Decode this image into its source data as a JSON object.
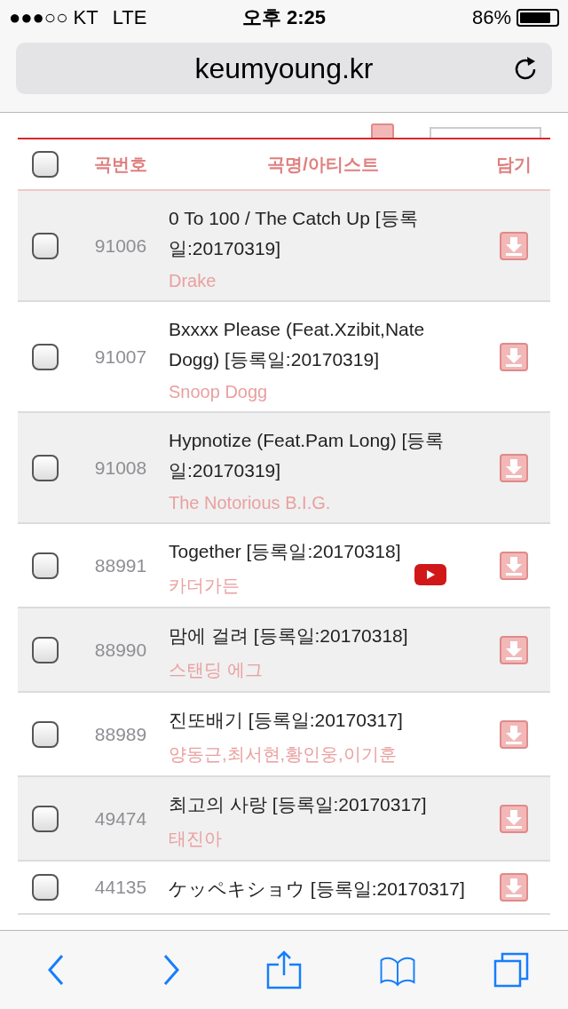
{
  "status_bar": {
    "carrier": "●●●○○ KT",
    "network": "LTE",
    "time": "오후 2:25",
    "battery": "86%"
  },
  "address_bar": {
    "url": "keumyoung.kr"
  },
  "table": {
    "all_checked": false,
    "columns": [
      "곡번호",
      "곡명/아티스트",
      "담기"
    ],
    "rows": [
      {
        "number": "91006",
        "title": "0 To 100 / The Catch Up [등록일:20170319]",
        "artist": "Drake",
        "checked": false,
        "video": false
      },
      {
        "number": "91007",
        "title": "Bxxxx Please (Feat.Xzibit,Nate Dogg) [등록일:20170319]",
        "artist": "Snoop Dogg",
        "checked": false,
        "video": false
      },
      {
        "number": "91008",
        "title": "Hypnotize (Feat.Pam Long) [등록일:20170319]",
        "artist": "The Notorious B.I.G.",
        "checked": false,
        "video": false
      },
      {
        "number": "88991",
        "title": "Together [등록일:20170318]",
        "artist": "카더가든",
        "checked": false,
        "video": true
      },
      {
        "number": "88990",
        "title": "맘에 걸려 [등록일:20170318]",
        "artist": "스탠딩 에그",
        "checked": false,
        "video": false
      },
      {
        "number": "88989",
        "title": "진또배기 [등록일:20170317]",
        "artist": "양동근,최서현,황인웅,이기훈",
        "checked": false,
        "video": false
      },
      {
        "number": "49474",
        "title": "최고의 사랑 [등록일:20170317]",
        "artist": "태진아",
        "checked": false,
        "video": false
      },
      {
        "number": "44135",
        "title": "ケッペキショウ [등록일:20170317]",
        "checked": false,
        "video": false
      }
    ]
  }
}
